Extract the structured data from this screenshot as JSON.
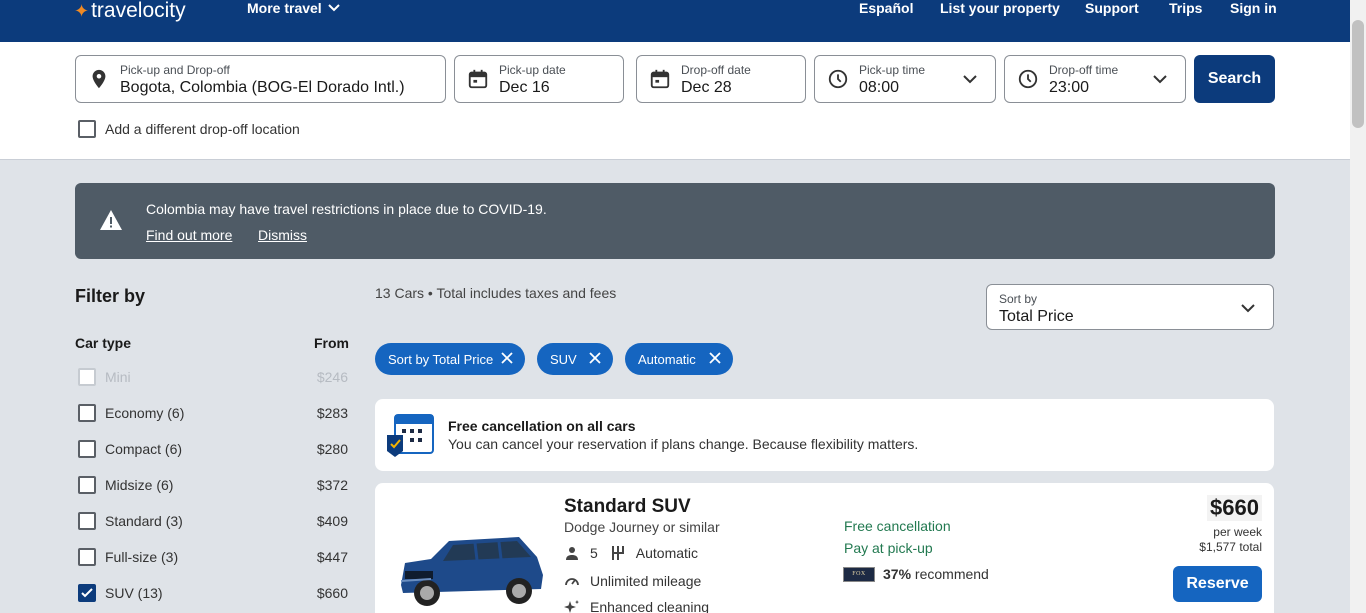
{
  "header": {
    "logo_text": "travelocity",
    "more_travel": "More travel",
    "nav": [
      "Español",
      "List your property",
      "Support",
      "Trips",
      "Sign in"
    ]
  },
  "search": {
    "location_label": "Pick-up and Drop-off",
    "location_value": "Bogota, Colombia (BOG-El Dorado Intl.)",
    "pickup_date_label": "Pick-up date",
    "pickup_date_value": "Dec 16",
    "dropoff_date_label": "Drop-off date",
    "dropoff_date_value": "Dec 28",
    "pickup_time_label": "Pick-up time",
    "pickup_time_value": "08:00",
    "dropoff_time_label": "Drop-off time",
    "dropoff_time_value": "23:00",
    "search_button": "Search",
    "different_dropoff_label": "Add a different drop-off location"
  },
  "alert": {
    "message": "Colombia may have travel restrictions in place due to COVID-19.",
    "find_out_more": "Find out more",
    "dismiss": "Dismiss"
  },
  "filters": {
    "title": "Filter by",
    "car_type_header": "Car type",
    "from_header": "From",
    "items": [
      {
        "label": "Mini",
        "price": "$246",
        "checked": false,
        "disabled": true
      },
      {
        "label": "Economy (6)",
        "price": "$283",
        "checked": false,
        "disabled": false
      },
      {
        "label": "Compact (6)",
        "price": "$280",
        "checked": false,
        "disabled": false
      },
      {
        "label": "Midsize (6)",
        "price": "$372",
        "checked": false,
        "disabled": false
      },
      {
        "label": "Standard (3)",
        "price": "$409",
        "checked": false,
        "disabled": false
      },
      {
        "label": "Full-size (3)",
        "price": "$447",
        "checked": false,
        "disabled": false
      },
      {
        "label": "SUV (13)",
        "price": "$660",
        "checked": true,
        "disabled": false
      }
    ]
  },
  "results": {
    "count_text": "13 Cars • Total includes taxes and fees",
    "sort_label": "Sort by",
    "sort_value": "Total Price",
    "chips": [
      "Sort by Total Price",
      "SUV",
      "Automatic"
    ],
    "banner_title": "Free cancellation on all cars",
    "banner_text": "You can cancel your reservation if plans change. Because flexibility matters."
  },
  "card": {
    "title": "Standard SUV",
    "subtitle": "Dodge Journey or similar",
    "seats": "5",
    "transmission": "Automatic",
    "mileage": "Unlimited mileage",
    "cleaning": "Enhanced cleaning",
    "free_cancel": "Free cancellation",
    "pay_at_pickup": "Pay at pick-up",
    "recommend_pct": "37%",
    "recommend_text": "recommend",
    "vendor_badge": "FOX",
    "price": "$660",
    "per_week": "per week",
    "total": "$1,577 total",
    "reserve": "Reserve"
  },
  "colors": {
    "header_bg": "#0c3b7c",
    "primary_button": "#1565c0",
    "alert_bg": "#4f5b66",
    "page_bg": "#dfe3e8",
    "success_text": "#227950"
  }
}
